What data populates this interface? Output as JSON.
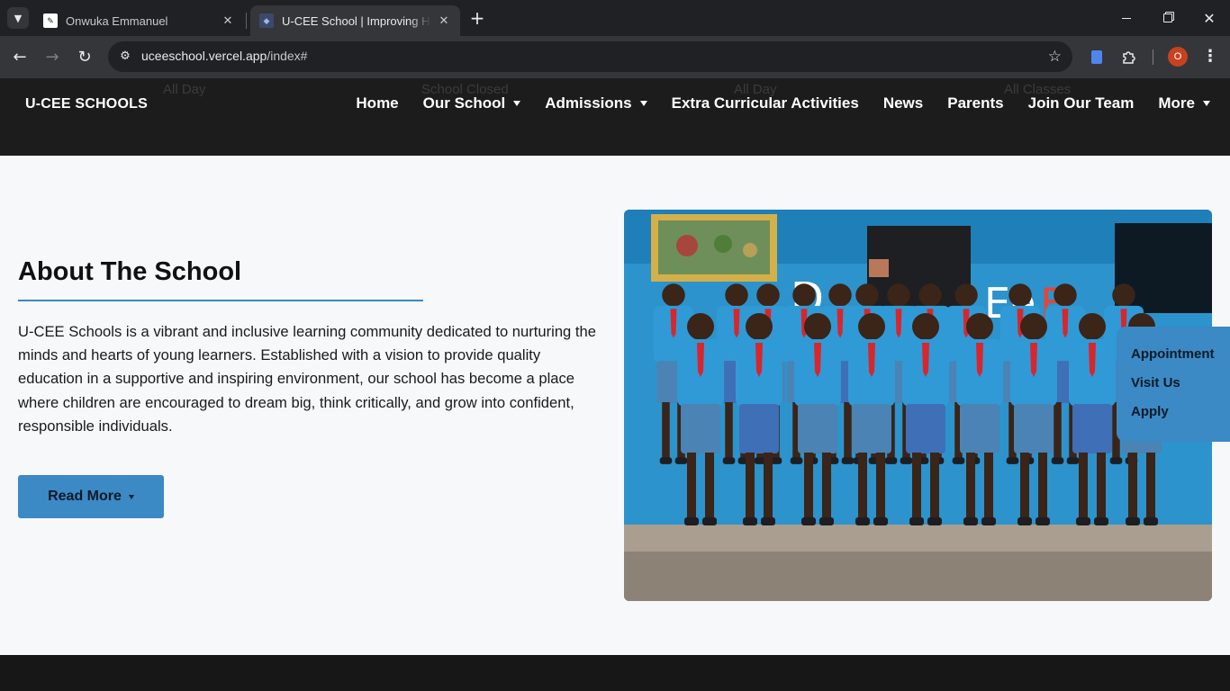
{
  "browser": {
    "tabs": [
      {
        "title": "Onwuka Emmanuel",
        "active": false
      },
      {
        "title": "U-CEE School | Improving Human",
        "active": true
      }
    ],
    "new_tab_label": "+",
    "url_host": "uceeschool.vercel.app",
    "url_path": "/index#",
    "profile_initial": "O",
    "icons": [
      "back-arrow-icon",
      "forward-arrow-icon",
      "reload-icon",
      "site-info-icon",
      "star-icon",
      "docs-extension-icon",
      "puzzle-icon",
      "menu-dots-icon",
      "minimize-icon",
      "maximize-icon",
      "close-icon"
    ]
  },
  "header": {
    "brand": "U-CEE SCHOOLS",
    "ghost_text": [
      "All Day",
      "School Closed",
      "All Day",
      "All Classes"
    ],
    "nav": [
      {
        "label": "Home",
        "has_dropdown": false
      },
      {
        "label": "Our School",
        "has_dropdown": true
      },
      {
        "label": "Admissions",
        "has_dropdown": true
      },
      {
        "label": "Extra Curricular Activities",
        "has_dropdown": false
      },
      {
        "label": "News",
        "has_dropdown": false
      },
      {
        "label": "Parents",
        "has_dropdown": false
      },
      {
        "label": "Join Our Team",
        "has_dropdown": false
      },
      {
        "label": "More",
        "has_dropdown": true
      }
    ]
  },
  "about": {
    "title": "About The School",
    "body": "U-CEE Schools is a vibrant and inclusive learning community dedicated to nurturing the minds and hearts of young learners. Established with a vision to provide quality education in a supportive and inspiring environment, our school has become a place where children are encouraged to dream big, think critically, and grow into confident, responsible individuals.",
    "read_more_label": "Read More"
  },
  "quick_links": [
    "Appointment",
    "Visit Us",
    "Apply"
  ],
  "colors": {
    "accent": "#3b89c5",
    "header_bg": "#1c1c1c",
    "section_bg": "#f7f8fa",
    "uniform_blue": "#2f9ad6"
  }
}
